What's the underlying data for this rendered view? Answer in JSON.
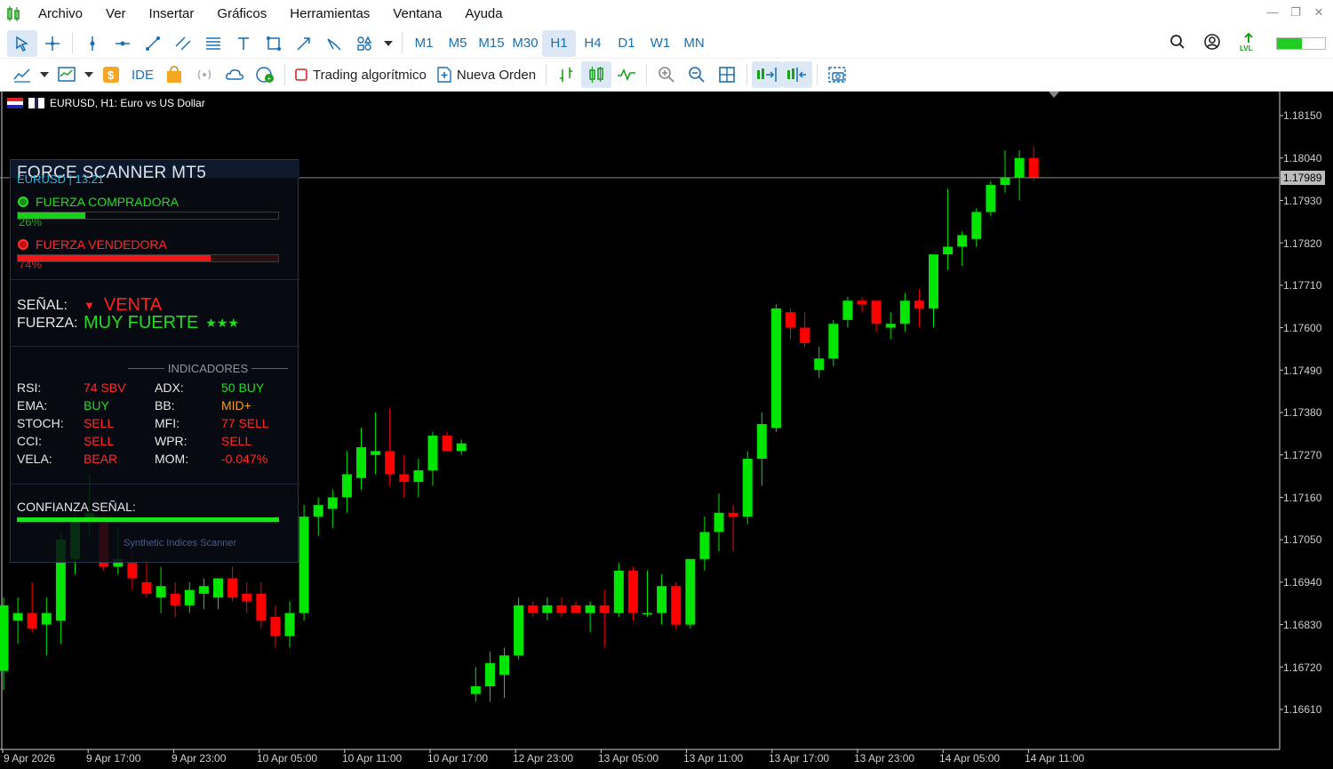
{
  "menu": [
    "Archivo",
    "Ver",
    "Insertar",
    "Gráficos",
    "Herramientas",
    "Ventana",
    "Ayuda"
  ],
  "toolbar": {
    "timeframes": [
      "M1",
      "M5",
      "M15",
      "M30",
      "H1",
      "H4",
      "D1",
      "W1",
      "MN"
    ],
    "active_timeframe": "H1",
    "ide_label": "IDE",
    "algo_trading_label": "Trading algorítmico",
    "new_order_label": "Nueva Orden"
  },
  "chart": {
    "title": "EURUSD, H1:  Euro vs US Dollar",
    "current_price": "1.17989",
    "price_labels": [
      "1.18150",
      "1.18040",
      "1.17930",
      "1.17820",
      "1.17710",
      "1.17600",
      "1.17490",
      "1.17380",
      "1.17270",
      "1.17160",
      "1.17050",
      "1.16940",
      "1.16830",
      "1.16720",
      "1.16610"
    ],
    "time_labels": [
      "9 Apr 2026",
      "9 Apr 17:00",
      "9 Apr 23:00",
      "10 Apr 05:00",
      "10 Apr 11:00",
      "10 Apr 17:00",
      "12 Apr 23:00",
      "13 Apr 05:00",
      "13 Apr 11:00",
      "13 Apr 17:00",
      "13 Apr 23:00",
      "14 Apr 05:00",
      "14 Apr 11:00"
    ]
  },
  "chart_data": {
    "type": "candlestick",
    "symbol": "EURUSD",
    "timeframe": "H1",
    "bull_color": "#00e600",
    "bear_color": "#ff0000",
    "ylim": [
      1.1655,
      1.182
    ],
    "candles": [
      {
        "o": 1.1671,
        "h": 1.169,
        "l": 1.1666,
        "c": 1.1688
      },
      {
        "o": 1.1684,
        "h": 1.169,
        "l": 1.1678,
        "c": 1.1686
      },
      {
        "o": 1.1686,
        "h": 1.1694,
        "l": 1.1681,
        "c": 1.1682
      },
      {
        "o": 1.1683,
        "h": 1.169,
        "l": 1.1675,
        "c": 1.1686
      },
      {
        "o": 1.1684,
        "h": 1.1707,
        "l": 1.1678,
        "c": 1.1705
      },
      {
        "o": 1.17,
        "h": 1.1712,
        "l": 1.1696,
        "c": 1.171
      },
      {
        "o": 1.171,
        "h": 1.1722,
        "l": 1.1706,
        "c": 1.1712
      },
      {
        "o": 1.171,
        "h": 1.1714,
        "l": 1.1697,
        "c": 1.1698
      },
      {
        "o": 1.1698,
        "h": 1.1708,
        "l": 1.1696,
        "c": 1.17
      },
      {
        "o": 1.1699,
        "h": 1.1702,
        "l": 1.1692,
        "c": 1.1695
      },
      {
        "o": 1.1694,
        "h": 1.17,
        "l": 1.169,
        "c": 1.1691
      },
      {
        "o": 1.169,
        "h": 1.1698,
        "l": 1.1686,
        "c": 1.1693
      },
      {
        "o": 1.1691,
        "h": 1.1694,
        "l": 1.1685,
        "c": 1.1688
      },
      {
        "o": 1.1688,
        "h": 1.1694,
        "l": 1.1686,
        "c": 1.1692
      },
      {
        "o": 1.1691,
        "h": 1.1695,
        "l": 1.1687,
        "c": 1.1693
      },
      {
        "o": 1.169,
        "h": 1.1695,
        "l": 1.1687,
        "c": 1.1695
      },
      {
        "o": 1.1695,
        "h": 1.1698,
        "l": 1.1689,
        "c": 1.169
      },
      {
        "o": 1.1691,
        "h": 1.1694,
        "l": 1.1686,
        "c": 1.1689
      },
      {
        "o": 1.1691,
        "h": 1.1694,
        "l": 1.1682,
        "c": 1.1684
      },
      {
        "o": 1.1685,
        "h": 1.1688,
        "l": 1.1677,
        "c": 1.168
      },
      {
        "o": 1.168,
        "h": 1.1689,
        "l": 1.1677,
        "c": 1.1686
      },
      {
        "o": 1.1686,
        "h": 1.1714,
        "l": 1.1684,
        "c": 1.1711
      },
      {
        "o": 1.1711,
        "h": 1.1716,
        "l": 1.1706,
        "c": 1.1714
      },
      {
        "o": 1.1713,
        "h": 1.1718,
        "l": 1.1708,
        "c": 1.1716
      },
      {
        "o": 1.1716,
        "h": 1.1728,
        "l": 1.1712,
        "c": 1.1722
      },
      {
        "o": 1.1721,
        "h": 1.1734,
        "l": 1.1718,
        "c": 1.1729
      },
      {
        "o": 1.1727,
        "h": 1.1738,
        "l": 1.1722,
        "c": 1.1728
      },
      {
        "o": 1.1728,
        "h": 1.1739,
        "l": 1.1719,
        "c": 1.1722
      },
      {
        "o": 1.1722,
        "h": 1.1727,
        "l": 1.1716,
        "c": 1.172
      },
      {
        "o": 1.172,
        "h": 1.1726,
        "l": 1.1716,
        "c": 1.1723
      },
      {
        "o": 1.1723,
        "h": 1.1733,
        "l": 1.1719,
        "c": 1.1732
      },
      {
        "o": 1.1732,
        "h": 1.1733,
        "l": 1.1728,
        "c": 1.1728
      },
      {
        "o": 1.1728,
        "h": 1.1731,
        "l": 1.1727,
        "c": 1.173
      },
      {
        "o": 1.1665,
        "h": 1.1672,
        "l": 1.1663,
        "c": 1.1667
      },
      {
        "o": 1.1667,
        "h": 1.1676,
        "l": 1.1663,
        "c": 1.1673
      },
      {
        "o": 1.167,
        "h": 1.1677,
        "l": 1.1664,
        "c": 1.1675
      },
      {
        "o": 1.1675,
        "h": 1.169,
        "l": 1.1674,
        "c": 1.1688
      },
      {
        "o": 1.1688,
        "h": 1.1689,
        "l": 1.1685,
        "c": 1.1686
      },
      {
        "o": 1.1686,
        "h": 1.169,
        "l": 1.1684,
        "c": 1.1688
      },
      {
        "o": 1.1688,
        "h": 1.169,
        "l": 1.1685,
        "c": 1.1686
      },
      {
        "o": 1.1688,
        "h": 1.1689,
        "l": 1.1686,
        "c": 1.1686
      },
      {
        "o": 1.1686,
        "h": 1.1689,
        "l": 1.1681,
        "c": 1.1688
      },
      {
        "o": 1.1688,
        "h": 1.1692,
        "l": 1.1677,
        "c": 1.1686
      },
      {
        "o": 1.1686,
        "h": 1.1699,
        "l": 1.1685,
        "c": 1.1697
      },
      {
        "o": 1.1697,
        "h": 1.1698,
        "l": 1.1684,
        "c": 1.1686
      },
      {
        "o": 1.1686,
        "h": 1.1697,
        "l": 1.1685,
        "c": 1.1686
      },
      {
        "o": 1.1686,
        "h": 1.1696,
        "l": 1.1683,
        "c": 1.1693
      },
      {
        "o": 1.1693,
        "h": 1.1694,
        "l": 1.1682,
        "c": 1.1683
      },
      {
        "o": 1.1683,
        "h": 1.17,
        "l": 1.1682,
        "c": 1.17
      },
      {
        "o": 1.17,
        "h": 1.1711,
        "l": 1.1697,
        "c": 1.1707
      },
      {
        "o": 1.1707,
        "h": 1.1717,
        "l": 1.1702,
        "c": 1.1712
      },
      {
        "o": 1.1712,
        "h": 1.1714,
        "l": 1.1702,
        "c": 1.1711
      },
      {
        "o": 1.1711,
        "h": 1.1728,
        "l": 1.1709,
        "c": 1.1726
      },
      {
        "o": 1.1726,
        "h": 1.1738,
        "l": 1.1719,
        "c": 1.1735
      },
      {
        "o": 1.1734,
        "h": 1.1766,
        "l": 1.1733,
        "c": 1.1765
      },
      {
        "o": 1.1764,
        "h": 1.1765,
        "l": 1.1757,
        "c": 1.176
      },
      {
        "o": 1.176,
        "h": 1.1764,
        "l": 1.1755,
        "c": 1.1756
      },
      {
        "o": 1.1749,
        "h": 1.1755,
        "l": 1.1747,
        "c": 1.1752
      },
      {
        "o": 1.1752,
        "h": 1.1762,
        "l": 1.175,
        "c": 1.1761
      },
      {
        "o": 1.1762,
        "h": 1.1768,
        "l": 1.176,
        "c": 1.1767
      },
      {
        "o": 1.1767,
        "h": 1.1768,
        "l": 1.1764,
        "c": 1.1766
      },
      {
        "o": 1.1767,
        "h": 1.1767,
        "l": 1.1759,
        "c": 1.1761
      },
      {
        "o": 1.176,
        "h": 1.1764,
        "l": 1.1757,
        "c": 1.1761
      },
      {
        "o": 1.1761,
        "h": 1.1769,
        "l": 1.1759,
        "c": 1.1767
      },
      {
        "o": 1.1767,
        "h": 1.177,
        "l": 1.176,
        "c": 1.1765
      },
      {
        "o": 1.1765,
        "h": 1.1779,
        "l": 1.176,
        "c": 1.1779
      },
      {
        "o": 1.1779,
        "h": 1.1796,
        "l": 1.1775,
        "c": 1.1781
      },
      {
        "o": 1.1781,
        "h": 1.1785,
        "l": 1.1776,
        "c": 1.1784
      },
      {
        "o": 1.1783,
        "h": 1.1791,
        "l": 1.1781,
        "c": 1.179
      },
      {
        "o": 1.179,
        "h": 1.1798,
        "l": 1.1789,
        "c": 1.1797
      },
      {
        "o": 1.1797,
        "h": 1.1806,
        "l": 1.1795,
        "c": 1.1799
      },
      {
        "o": 1.1799,
        "h": 1.1806,
        "l": 1.1793,
        "c": 1.1804
      },
      {
        "o": 1.1804,
        "h": 1.1807,
        "l": 1.1798,
        "c": 1.1799
      }
    ]
  },
  "scanner": {
    "title": "FORCE SCANNER MT5",
    "subtitle": "EURUSD | 13:21",
    "buy_label": "FUERZA COMPRADORA",
    "buy_pct_label": "26%",
    "buy_pct": 26,
    "sell_label": "FUERZA VENDEDORA",
    "sell_pct_label": "74%",
    "sell_pct": 74,
    "signal_key": "SEÑAL:",
    "signal_value": "VENTA",
    "strength_key": "FUERZA:",
    "strength_value": "MUY FUERTE",
    "strength_stars": "★★★",
    "indicators_header": "INDICADORES",
    "indicators": [
      {
        "name": "RSI:",
        "value": "74 SBV",
        "color": "#ff2a2a"
      },
      {
        "name": "EMA:",
        "value": "BUY",
        "color": "#22dd22"
      },
      {
        "name": "STOCH:",
        "value": "SELL",
        "color": "#ff2a2a"
      },
      {
        "name": "CCI:",
        "value": "SELL",
        "color": "#ff2a2a"
      },
      {
        "name": "VELA:",
        "value": "BEAR",
        "color": "#ff2a2a"
      },
      {
        "name": "ADX:",
        "value": "50 BUY",
        "color": "#22dd22"
      },
      {
        "name": "BB:",
        "value": "MID+",
        "color": "#f0a020"
      },
      {
        "name": "MFI:",
        "value": "77 SELL",
        "color": "#ff2a2a"
      },
      {
        "name": "WPR:",
        "value": "SELL",
        "color": "#ff2a2a"
      },
      {
        "name": "MOM:",
        "value": "-0.047%",
        "color": "#ff2a2a"
      }
    ],
    "confidence_label": "CONFIANZA SEÑAL:",
    "footer": "Synthetic Indices Scanner"
  }
}
